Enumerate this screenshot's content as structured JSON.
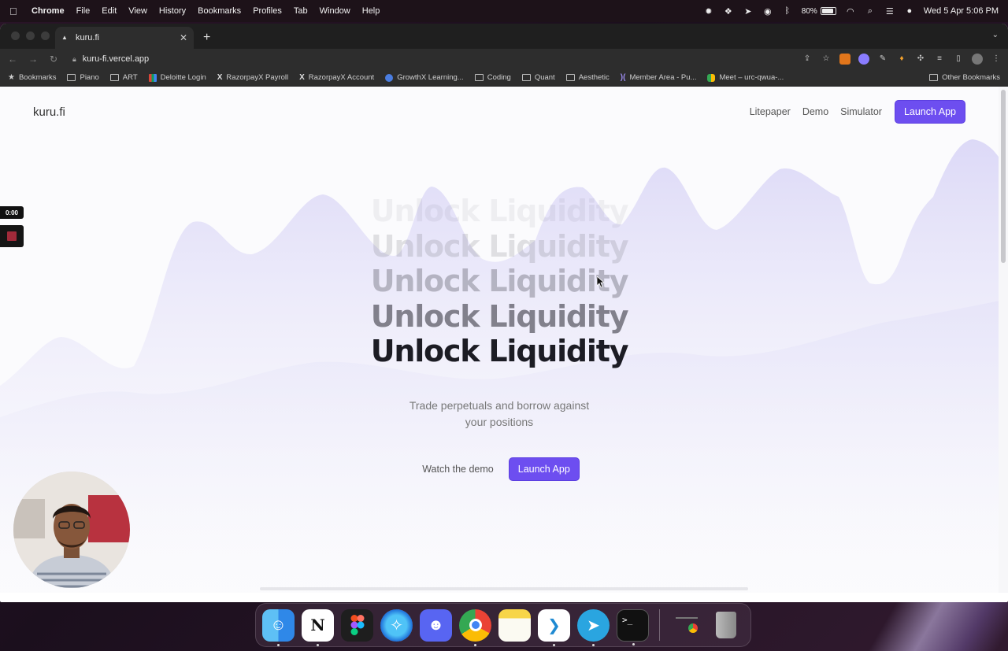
{
  "menubar": {
    "app_name": "Chrome",
    "items": [
      "File",
      "Edit",
      "View",
      "History",
      "Bookmarks",
      "Profiles",
      "Tab",
      "Window",
      "Help"
    ],
    "battery": "80%",
    "datetime": "Wed 5 Apr  5:06 PM"
  },
  "browser": {
    "tab_title": "kuru.fi",
    "url": "kuru-fi.vercel.app",
    "bookmarks": [
      {
        "label": "Bookmarks",
        "icon": "star-icon"
      },
      {
        "label": "Piano",
        "icon": "folder-icon"
      },
      {
        "label": "ART",
        "icon": "folder-icon"
      },
      {
        "label": "Deloitte Login",
        "icon": "deloitte-icon"
      },
      {
        "label": "RazorpayX Payroll",
        "icon": "x-icon"
      },
      {
        "label": "RazorpayX Account",
        "icon": "x-icon"
      },
      {
        "label": "GrowthX Learning...",
        "icon": "globe-icon"
      },
      {
        "label": "Coding",
        "icon": "folder-icon"
      },
      {
        "label": "Quant",
        "icon": "folder-icon"
      },
      {
        "label": "Aesthetic",
        "icon": "folder-icon"
      },
      {
        "label": "Member Area - Pu...",
        "icon": "member-icon"
      },
      {
        "label": "Meet – urc-qwua-...",
        "icon": "meet-icon"
      }
    ],
    "other_bookmarks": "Other Bookmarks"
  },
  "site": {
    "logo": "kuru.fi",
    "nav": {
      "litepaper": "Litepaper",
      "demo": "Demo",
      "simulator": "Simulator",
      "launch": "Launch App"
    },
    "hero_lines": [
      "Unlock Liquidity",
      "Unlock Liquidity",
      "Unlock Liquidity",
      "Unlock Liquidity",
      "Unlock Liquidity"
    ],
    "subtitle_1": "Trade perpetuals and borrow against",
    "subtitle_2": "your positions",
    "cta_watch": "Watch the demo",
    "cta_launch": "Launch App",
    "accent_color": "#6d4ef0"
  },
  "recording": {
    "timer": "0:00"
  },
  "dock": {
    "apps": [
      "finder-icon",
      "notion-icon",
      "figma-icon",
      "safari-icon",
      "discord-icon",
      "chrome-icon",
      "notes-icon",
      "vscode-icon",
      "telegram-icon",
      "terminal-icon",
      "downloads-icon",
      "trash-icon"
    ]
  }
}
